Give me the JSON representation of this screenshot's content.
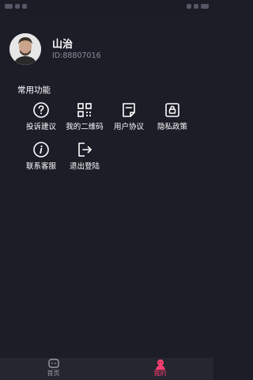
{
  "profile": {
    "name": "山治",
    "id_text": "ID:88807016"
  },
  "section": {
    "title": "常用功能"
  },
  "features": [
    {
      "label": "投诉建议",
      "icon": "question-icon"
    },
    {
      "label": "我的二维码",
      "icon": "qr-code-icon"
    },
    {
      "label": "用户协议",
      "icon": "document-icon"
    },
    {
      "label": "隐私政策",
      "icon": "lock-icon"
    },
    {
      "label": "联系客服",
      "icon": "info-icon"
    },
    {
      "label": "退出登陆",
      "icon": "logout-icon"
    }
  ],
  "tabbar": {
    "home_label": "首页",
    "me_label": "我的",
    "active": "me",
    "active_color": "#ff3f72"
  }
}
